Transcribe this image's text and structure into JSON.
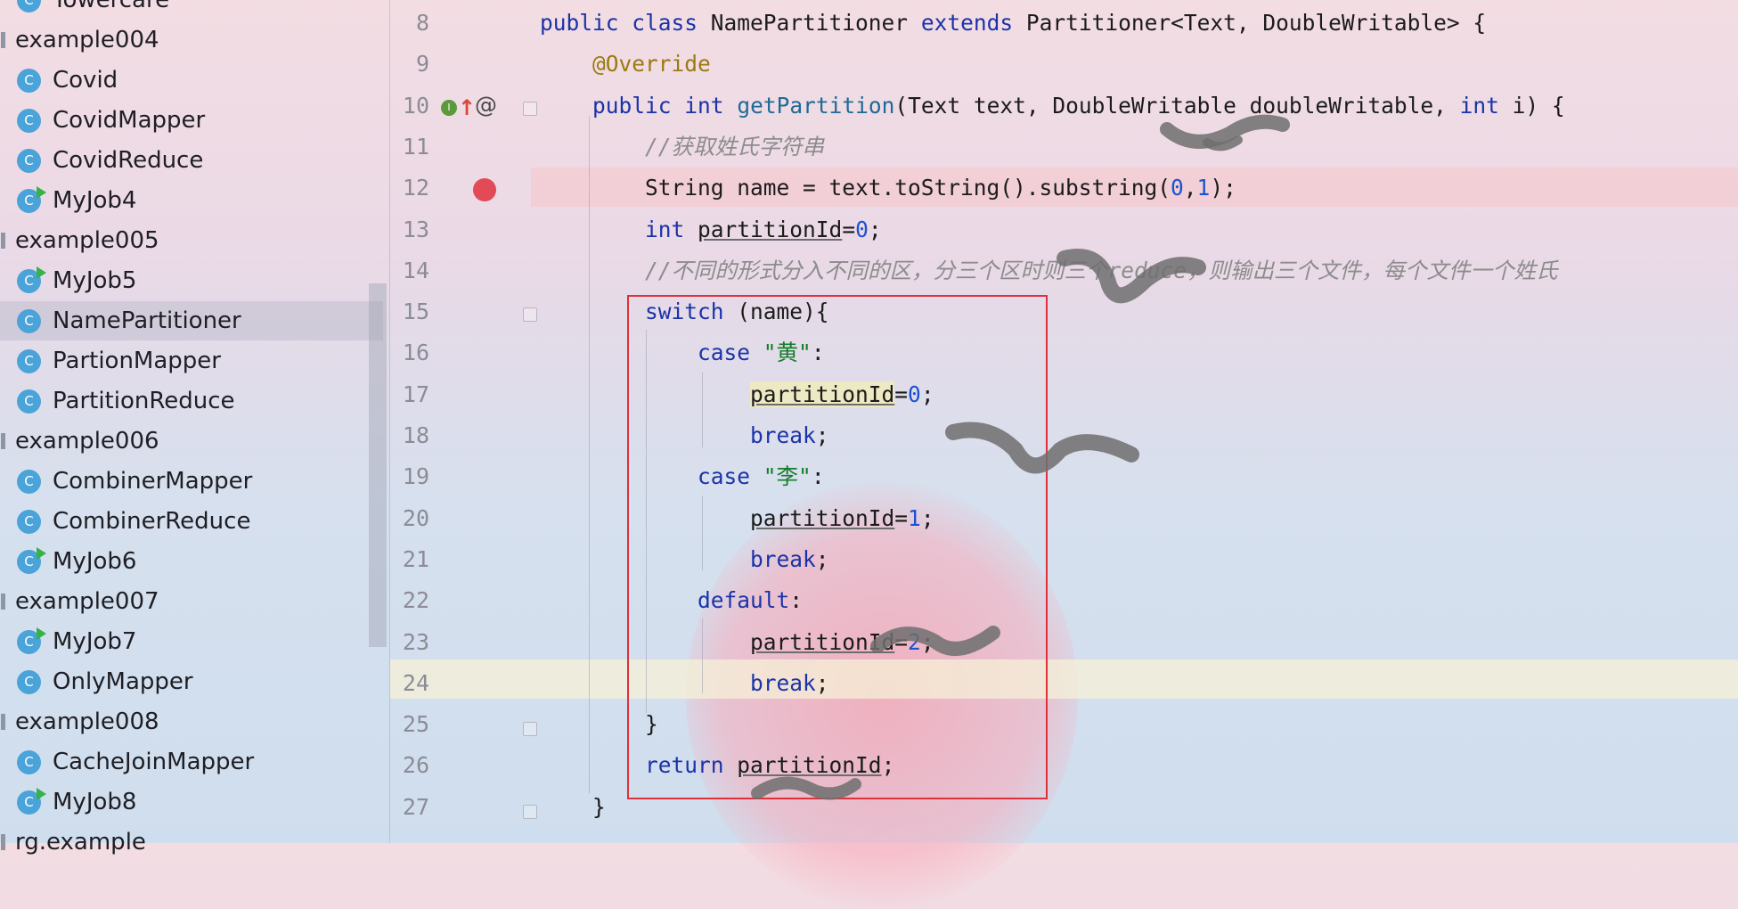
{
  "sidebar": {
    "rows": [
      {
        "type": "class",
        "label": "Towercare",
        "runnable": false
      },
      {
        "type": "package",
        "label": "example004"
      },
      {
        "type": "class",
        "label": "Covid",
        "runnable": false
      },
      {
        "type": "class",
        "label": "CovidMapper",
        "runnable": false
      },
      {
        "type": "class",
        "label": "CovidReduce",
        "runnable": false
      },
      {
        "type": "class",
        "label": "MyJob4",
        "runnable": true
      },
      {
        "type": "package",
        "label": "example005"
      },
      {
        "type": "class",
        "label": "MyJob5",
        "runnable": true
      },
      {
        "type": "class",
        "label": "NamePartitioner",
        "runnable": false,
        "selected": true
      },
      {
        "type": "class",
        "label": "PartionMapper",
        "runnable": false
      },
      {
        "type": "class",
        "label": "PartitionReduce",
        "runnable": false
      },
      {
        "type": "package",
        "label": "example006"
      },
      {
        "type": "class",
        "label": "CombinerMapper",
        "runnable": false
      },
      {
        "type": "class",
        "label": "CombinerReduce",
        "runnable": false
      },
      {
        "type": "class",
        "label": "MyJob6",
        "runnable": true
      },
      {
        "type": "package",
        "label": "example007"
      },
      {
        "type": "class",
        "label": "MyJob7",
        "runnable": true
      },
      {
        "type": "class",
        "label": "OnlyMapper",
        "runnable": false
      },
      {
        "type": "package",
        "label": "example008"
      },
      {
        "type": "class",
        "label": "CacheJoinMapper",
        "runnable": false
      },
      {
        "type": "class",
        "label": "MyJob8",
        "runnable": true
      },
      {
        "type": "package",
        "label": "rg.example"
      }
    ],
    "class_icon_letter": "C",
    "icon_names": {
      "class": "class-icon",
      "package": "package-icon",
      "run": "run-badge-icon"
    }
  },
  "editor": {
    "line_numbers": [
      "8",
      "9",
      "10",
      "11",
      "12",
      "13",
      "14",
      "15",
      "16",
      "17",
      "18",
      "19",
      "20",
      "21",
      "22",
      "23",
      "24",
      "25",
      "26",
      "27"
    ],
    "lines": [
      [
        {
          "t": "public",
          "c": "kw"
        },
        {
          "t": " "
        },
        {
          "t": "class",
          "c": "kw"
        },
        {
          "t": " NamePartitioner "
        },
        {
          "t": "extends",
          "c": "kw"
        },
        {
          "t": " Partitioner<Text, DoubleWritable> {"
        }
      ],
      [
        {
          "t": "    "
        },
        {
          "t": "@Override",
          "c": "ann"
        }
      ],
      [
        {
          "t": "    "
        },
        {
          "t": "public",
          "c": "kw"
        },
        {
          "t": " "
        },
        {
          "t": "int",
          "c": "kw"
        },
        {
          "t": " "
        },
        {
          "t": "getPartition",
          "c": "fn"
        },
        {
          "t": "(Text text, DoubleWritable doubleWritable, "
        },
        {
          "t": "int",
          "c": "kw"
        },
        {
          "t": " i) {"
        }
      ],
      [
        {
          "t": "        "
        },
        {
          "t": "//获取姓氏字符串",
          "c": "cmt"
        }
      ],
      [
        {
          "t": "        String name = text.toString().substring("
        },
        {
          "t": "0",
          "c": "num"
        },
        {
          "t": ","
        },
        {
          "t": "1",
          "c": "num"
        },
        {
          "t": ");"
        }
      ],
      [
        {
          "t": "        "
        },
        {
          "t": "int",
          "c": "kw"
        },
        {
          "t": " "
        },
        {
          "t": "partitionId",
          "c": "ul"
        },
        {
          "t": "="
        },
        {
          "t": "0",
          "c": "num"
        },
        {
          "t": ";"
        }
      ],
      [
        {
          "t": "        "
        },
        {
          "t": "//不同的形式分入不同的区，分三个区时则三个reduce，则输出三个文件，每个文件一个姓氏",
          "c": "cmt"
        }
      ],
      [
        {
          "t": "        "
        },
        {
          "t": "switch",
          "c": "kw"
        },
        {
          "t": " (name){"
        }
      ],
      [
        {
          "t": "            "
        },
        {
          "t": "case",
          "c": "kw"
        },
        {
          "t": " "
        },
        {
          "t": "\"黄\"",
          "c": "str"
        },
        {
          "t": ":"
        }
      ],
      [
        {
          "t": "                "
        },
        {
          "t": "partitionId",
          "c": "ul hl-var"
        },
        {
          "t": "="
        },
        {
          "t": "0",
          "c": "num"
        },
        {
          "t": ";"
        }
      ],
      [
        {
          "t": "                "
        },
        {
          "t": "break",
          "c": "kw"
        },
        {
          "t": ";"
        }
      ],
      [
        {
          "t": "            "
        },
        {
          "t": "case",
          "c": "kw"
        },
        {
          "t": " "
        },
        {
          "t": "\"李\"",
          "c": "str"
        },
        {
          "t": ":"
        }
      ],
      [
        {
          "t": "                "
        },
        {
          "t": "partitionId",
          "c": "ul"
        },
        {
          "t": "="
        },
        {
          "t": "1",
          "c": "num"
        },
        {
          "t": ";"
        }
      ],
      [
        {
          "t": "                "
        },
        {
          "t": "break",
          "c": "kw"
        },
        {
          "t": ";"
        }
      ],
      [
        {
          "t": "            "
        },
        {
          "t": "default",
          "c": "kw"
        },
        {
          "t": ":"
        }
      ],
      [
        {
          "t": "                "
        },
        {
          "t": "partitionId",
          "c": "ul"
        },
        {
          "t": "="
        },
        {
          "t": "2",
          "c": "num"
        },
        {
          "t": ";"
        }
      ],
      [
        {
          "t": "                "
        },
        {
          "t": "break",
          "c": "kw"
        },
        {
          "t": ";"
        }
      ],
      [
        {
          "t": "        }"
        }
      ],
      [
        {
          "t": "        "
        },
        {
          "t": "return",
          "c": "kw"
        },
        {
          "t": " "
        },
        {
          "t": "partitionId",
          "c": "ul"
        },
        {
          "t": ";"
        }
      ],
      [
        {
          "t": "    }"
        }
      ]
    ],
    "breakpoint_line": "12",
    "current_line": "24",
    "gutter_icons": [
      "implements-icon",
      "override-up-arrow-icon",
      "at-annotation-icon",
      "breakpoint-icon"
    ]
  },
  "colors": {
    "keyword": "#1a33a8",
    "annotation": "#9b7a10",
    "string": "#147d29",
    "number": "#1b52d1",
    "comment": "#8c8c8c",
    "breakpoint": "#e24a55",
    "annotation_box": "#e0303a",
    "class_icon": "#4aa3d9",
    "run_badge": "#35b24a"
  }
}
